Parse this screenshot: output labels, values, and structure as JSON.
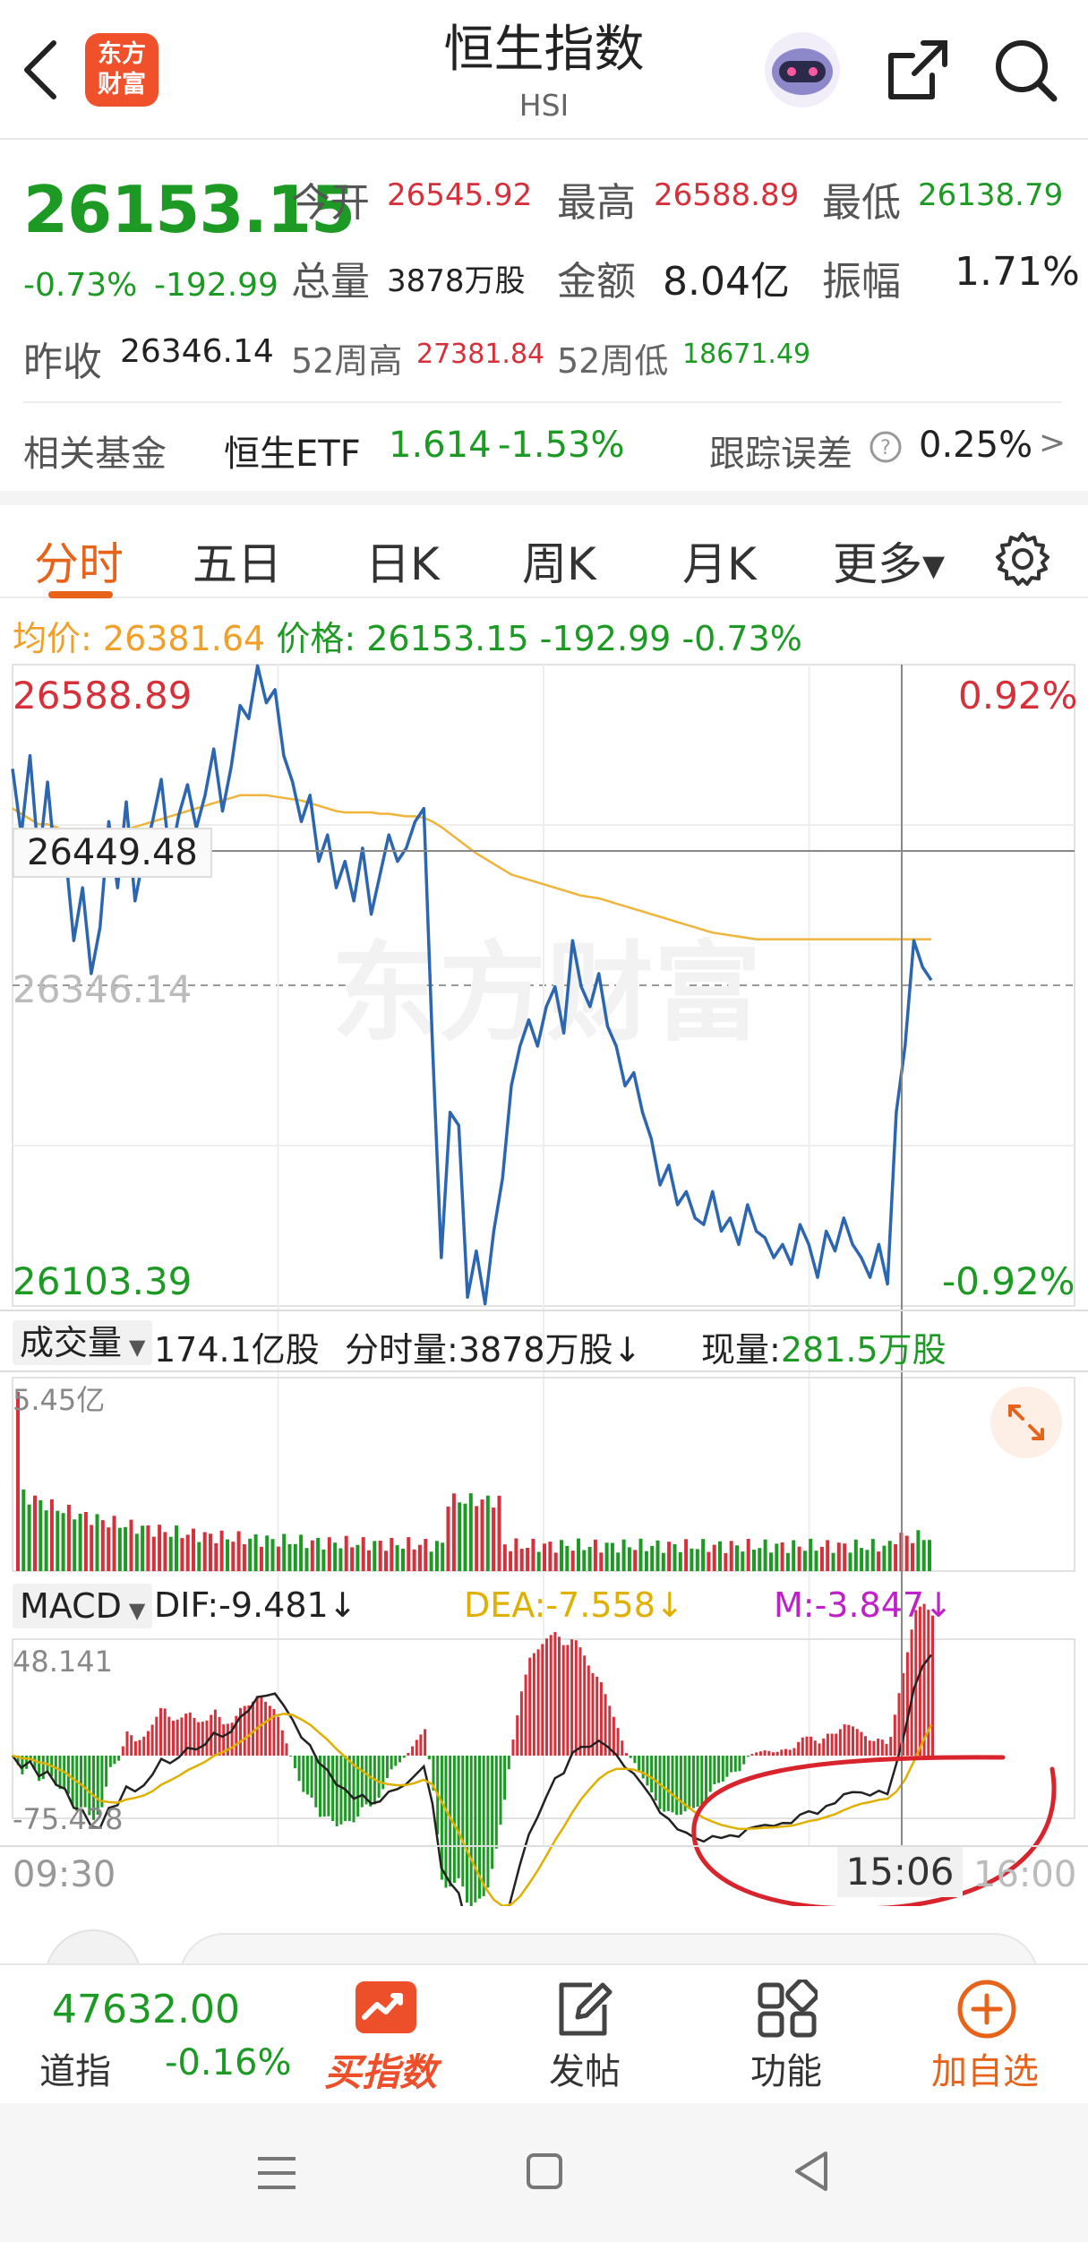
{
  "header": {
    "title": "恒生指数",
    "subtitle": "HSI",
    "logo_line1": "东方",
    "logo_line2": "财富",
    "icons": [
      "back-arrow-icon",
      "robot-avatar-icon",
      "share-icon",
      "search-icon"
    ]
  },
  "quote": {
    "price": "26153.15",
    "change_pct": "-0.73%",
    "change": "-192.99",
    "open_label": "今开",
    "open": "26545.92",
    "high_label": "最高",
    "high": "26588.89",
    "low_label": "最低",
    "low": "26138.79",
    "volume_label": "总量",
    "volume": "3878万股",
    "amount_label": "金额",
    "amount": "8.04亿",
    "amplitude_label": "振幅",
    "amplitude": "1.71%",
    "prev_close_label": "昨收",
    "prev_close": "26346.14",
    "w52_high_label": "52周高",
    "w52_high": "27381.84",
    "w52_low_label": "52周低",
    "w52_low": "18671.49"
  },
  "fund": {
    "label": "相关基金",
    "name": "恒生ETF",
    "price": "1.614",
    "change_pct": "-1.53%",
    "tracking_label": "跟踪误差",
    "tracking_value": "0.25%",
    "more": ">"
  },
  "tabs": [
    "分时",
    "五日",
    "日K",
    "周K",
    "月K",
    "更多▾"
  ],
  "active_tab": "分时",
  "chart_info": {
    "avg_label": "均价:",
    "avg_value": "26381.64",
    "price_label": "价格:",
    "price_value": "26153.15",
    "change": "-192.99",
    "change_pct": "-0.73%"
  },
  "chart_labels": {
    "top_price": "26588.89",
    "top_pct": "0.92%",
    "mid_price": "26346.14",
    "bottom_price": "26103.39",
    "bottom_pct": "-0.92%",
    "crosshair_value": "26449.48",
    "watermark": "东方财富"
  },
  "volume_bar": {
    "selector": "成交量",
    "total": "174.1亿股",
    "tick_label": "分时量:",
    "tick_value": "3878万股↓",
    "now_label": "现量:",
    "now_value": "281.5万股",
    "max_label": "5.45亿"
  },
  "macd_bar": {
    "selector": "MACD",
    "dif": "DIF:-9.481↓",
    "dea": "DEA:-7.558↓",
    "m": "M:-3.847↓",
    "max_label": "48.141",
    "min_label": "-75.428"
  },
  "time_axis": {
    "start": "09:30",
    "crosshair": "15:06",
    "end": "16:00"
  },
  "colors": {
    "up": "#d6303a",
    "down": "#1c9a24",
    "price_line": "#2c66b0",
    "avg_line": "#f0b43c",
    "accent": "#e8631a",
    "dea": "#e0b000",
    "m": "#c020c8"
  },
  "chart_data": {
    "type": "line",
    "x_range": [
      "09:30",
      "16:00"
    ],
    "ylim": [
      26103.39,
      26588.89
    ],
    "reference": 26346.14,
    "series": [
      {
        "values": [
          26510,
          26460,
          26520,
          26440,
          26500,
          26430,
          26450,
          26380,
          26420,
          26355,
          26390,
          26470,
          26420,
          26485,
          26410,
          26445,
          26470,
          26502,
          26440,
          26475,
          26498,
          26465,
          26490,
          26525,
          26478,
          26512,
          26558,
          26548,
          26588,
          26560,
          26570,
          26520,
          26500,
          26470,
          26490,
          26440,
          26460,
          26420,
          26440,
          26410,
          26450,
          26400,
          26430,
          26460,
          26440,
          26450,
          26470,
          26480,
          26300,
          26140,
          26250,
          26240,
          26110,
          26145,
          26105,
          26160,
          26200,
          26270,
          26300,
          26320,
          26300,
          26330,
          26345,
          26310,
          26380,
          26345,
          26330,
          26355,
          26315,
          26300,
          26270,
          26280,
          26250,
          26230,
          26195,
          26210,
          26180,
          26190,
          26170,
          26165,
          26190,
          26160,
          26170,
          26150,
          26180,
          26160,
          26155,
          26140,
          26150,
          26135,
          26165,
          26150,
          26125,
          26160,
          26145,
          26170,
          26150,
          26140,
          26125,
          26150,
          26120,
          26250,
          26300,
          26380,
          26360,
          26350
        ]
      },
      {
        "values": [
          26480,
          26476,
          26472,
          26468,
          26468,
          26466,
          26462,
          26460,
          26458,
          26456,
          26455,
          26460,
          26462,
          26464,
          26466,
          26468,
          26470,
          26472,
          26474,
          26476,
          26478,
          26480,
          26482,
          26484,
          26486,
          26488,
          26490,
          26490,
          26490,
          26490,
          26489,
          26488,
          26487,
          26486,
          26484,
          26482,
          26480,
          26478,
          26477,
          26477,
          26477,
          26477,
          26476,
          26476,
          26475,
          26474,
          26474,
          26473,
          26470,
          26466,
          26461,
          26456,
          26451,
          26446,
          26442,
          26438,
          26434,
          26430,
          26428,
          26426,
          26424,
          26422,
          26420,
          26418,
          26416,
          26414,
          26413,
          26412,
          26410,
          26408,
          26406,
          26404,
          26402,
          26400,
          26398,
          26396,
          26394,
          26392,
          26390,
          26388,
          26386,
          26385,
          26384,
          26383,
          26382,
          26381,
          26381,
          26381,
          26381,
          26381,
          26381,
          26381,
          26381,
          26381,
          26381,
          26381,
          26381,
          26381,
          26381,
          26381,
          26381,
          26381,
          26381,
          26381,
          26381,
          26381
        ]
      }
    ]
  },
  "bottom_bar": {
    "index_value": "47632.00",
    "index_name": "道指",
    "index_pct": "-0.16%",
    "buy_label": "买指数",
    "post_label": "发帖",
    "func_label": "功能",
    "add_label": "加自选"
  }
}
